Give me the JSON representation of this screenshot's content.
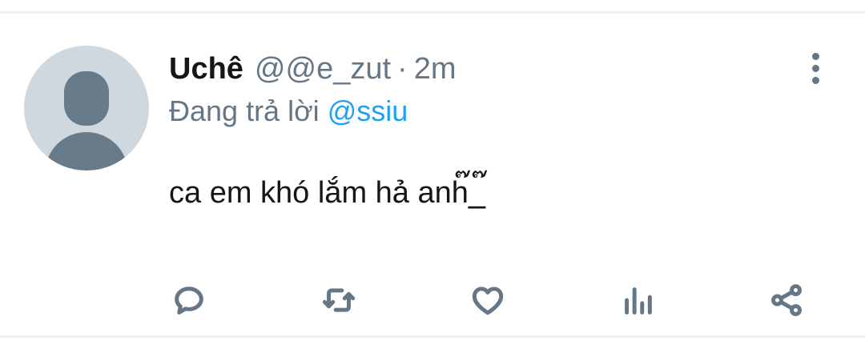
{
  "tweet": {
    "author_name": "Uchê",
    "author_handle": "@@e_zut",
    "separator": "·",
    "time_ago": "2m",
    "reply_prefix": "Đang trả lời",
    "reply_to": "@ssiu",
    "text": "ca em khó lắm hả anh๊_๊"
  },
  "icons": {
    "avatar": "default-avatar-icon",
    "more": "more-vertical-icon",
    "reply": "reply-icon",
    "retweet": "retweet-icon",
    "like": "heart-icon",
    "analytics": "analytics-icon",
    "share": "share-icon"
  },
  "colors": {
    "text_primary": "#14171a",
    "text_secondary": "#657786",
    "link": "#1da1f2",
    "avatar_bg": "#ced8de",
    "avatar_fg": "#687b8b",
    "divider": "#eef0f2"
  }
}
